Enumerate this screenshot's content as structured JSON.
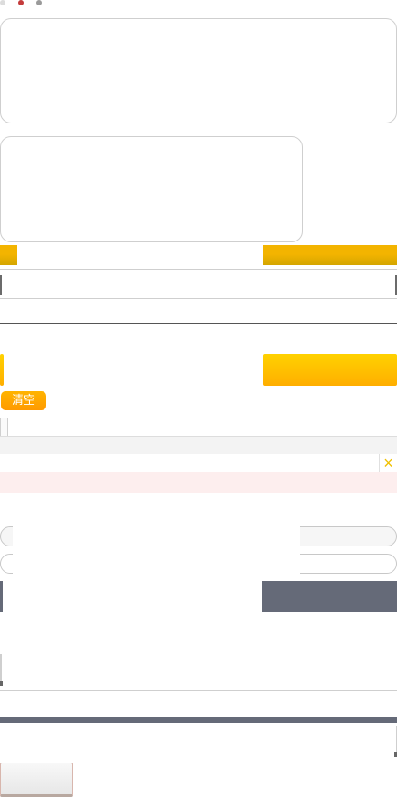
{
  "toolbar": {
    "clear_label": "清空",
    "close_glyph": "×"
  },
  "colors": {
    "accent_orange": "#f3b400",
    "button_gold": "#ffc800",
    "alert_bg": "#fdeeee",
    "dark_bar": "#656a78",
    "close_x": "#f0c000"
  },
  "icons": [
    "close-icon"
  ]
}
